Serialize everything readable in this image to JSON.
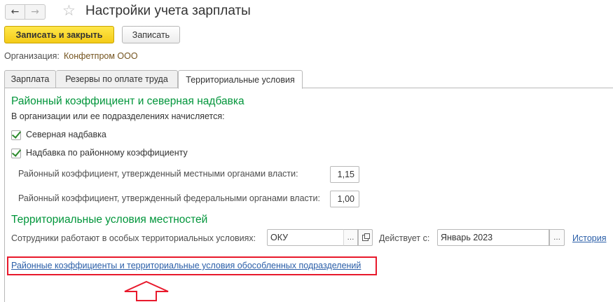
{
  "window": {
    "title": "Настройки учета зарплаты",
    "back_icon": "arrow-left-icon",
    "forward_icon": "arrow-right-icon",
    "favorite_icon": "star-icon"
  },
  "toolbar": {
    "save_close_label": "Записать и закрыть",
    "save_label": "Записать"
  },
  "organization": {
    "label": "Организация:",
    "value": "Конфетпром ООО"
  },
  "tabs": [
    {
      "label": "Зарплата",
      "active": false
    },
    {
      "label": "Резервы по оплате труда",
      "active": false
    },
    {
      "label": "Территориальные условия",
      "active": true
    }
  ],
  "regional": {
    "heading": "Районный коэффициент и северная надбавка",
    "description": "В организации или ее подразделениях начисляется:",
    "northern_allowance": {
      "label": "Северная надбавка",
      "checked": true
    },
    "regional_allowance": {
      "label": "Надбавка по районному коэффициенту",
      "checked": true
    },
    "local_coef": {
      "label": "Районный коэффициент, утвержденный местными органами власти:",
      "value": "1,15"
    },
    "federal_coef": {
      "label": "Районный коэффициент, утвержденный федеральными органами власти:",
      "value": "1,00"
    }
  },
  "territorial": {
    "heading": "Территориальные условия местностей",
    "employees_label": "Сотрудники работают в особых территориальных условиях:",
    "employees_value": "ОКУ",
    "valid_from_label": "Действует с:",
    "valid_from_value": "Январь 2023",
    "history_link": "История",
    "subdivisions_link": "Районные коэффициенты и территориальные условия обособленных подразделений"
  },
  "colors": {
    "accent_green": "#00953a",
    "primary_button": "#f4cb18",
    "link_blue": "#2a5ea8",
    "highlight_red": "#e8192c"
  }
}
